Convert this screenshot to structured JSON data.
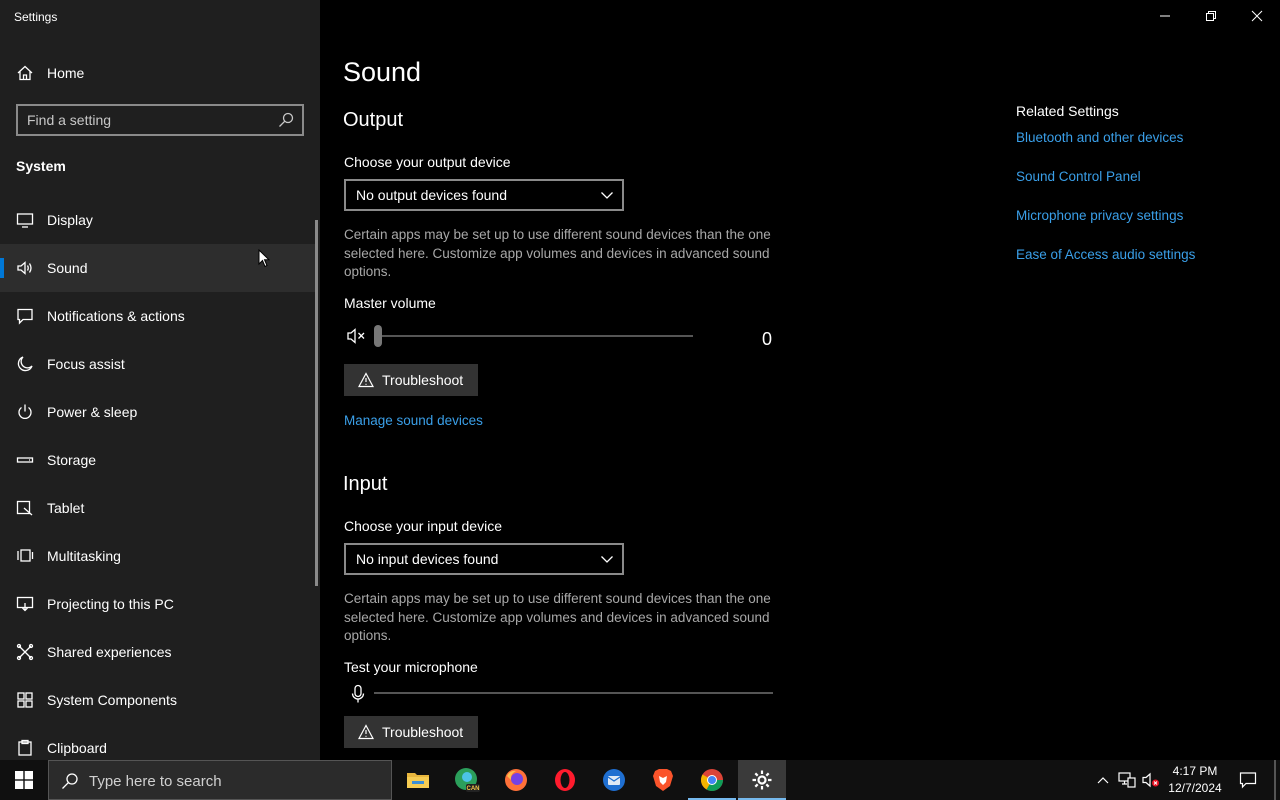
{
  "window": {
    "title": "Settings",
    "controls": {
      "minimize": "minimize-icon",
      "restore": "restore-icon",
      "close": "close-icon"
    }
  },
  "sidebar": {
    "home_label": "Home",
    "search": {
      "placeholder": "Find a setting"
    },
    "section": "System",
    "items": [
      {
        "label": "Display",
        "icon": "monitor-icon"
      },
      {
        "label": "Sound",
        "icon": "speaker-icon",
        "active": true
      },
      {
        "label": "Notifications & actions",
        "icon": "notification-icon"
      },
      {
        "label": "Focus assist",
        "icon": "moon-icon"
      },
      {
        "label": "Power & sleep",
        "icon": "power-icon"
      },
      {
        "label": "Storage",
        "icon": "storage-icon"
      },
      {
        "label": "Tablet",
        "icon": "tablet-icon"
      },
      {
        "label": "Multitasking",
        "icon": "multitasking-icon"
      },
      {
        "label": "Projecting to this PC",
        "icon": "projecting-icon"
      },
      {
        "label": "Shared experiences",
        "icon": "shared-icon"
      },
      {
        "label": "System Components",
        "icon": "components-icon"
      },
      {
        "label": "Clipboard",
        "icon": "clipboard-icon"
      }
    ]
  },
  "main": {
    "title": "Sound",
    "output": {
      "heading": "Output",
      "device_label": "Choose your output device",
      "device_value": "No output devices found",
      "note": "Certain apps may be set up to use different sound devices than the one selected here. Customize app volumes and devices in advanced sound options.",
      "volume_label": "Master volume",
      "volume_value": "0",
      "troubleshoot": "Troubleshoot",
      "manage_link": "Manage sound devices"
    },
    "input": {
      "heading": "Input",
      "device_label": "Choose your input device",
      "device_value": "No input devices found",
      "note": "Certain apps may be set up to use different sound devices than the one selected here. Customize app volumes and devices in advanced sound options.",
      "test_label": "Test your microphone",
      "troubleshoot": "Troubleshoot"
    }
  },
  "related": {
    "heading": "Related Settings",
    "links": [
      "Bluetooth and other devices",
      "Sound Control Panel",
      "Microphone privacy settings",
      "Ease of Access audio settings"
    ]
  },
  "taskbar": {
    "search_placeholder": "Type here to search",
    "apps": [
      "file-explorer-icon",
      "edge-canary-icon",
      "firefox-icon",
      "opera-icon",
      "thunderbird-icon",
      "brave-icon",
      "chrome-icon",
      "settings-gear-icon"
    ],
    "time": "4:17 PM",
    "date": "12/7/2024"
  },
  "colors": {
    "accent": "#0078d7",
    "link": "#3a9fe8",
    "sidebar_bg": "#1f1f1f",
    "main_bg": "#000000"
  }
}
